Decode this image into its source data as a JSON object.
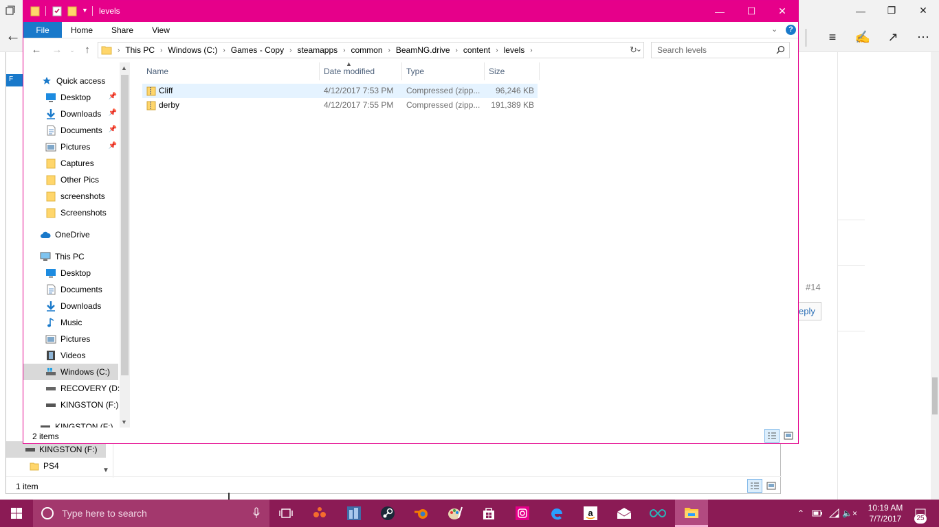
{
  "edge": {
    "post_number": "#14",
    "reply_label": "eply"
  },
  "bg_explorer": {
    "nav_items": [
      "KINGSTON (F:)",
      "PS4"
    ],
    "status": "1 item",
    "tab_letter": "F"
  },
  "window": {
    "title": "levels",
    "ribbon_tabs": [
      "File",
      "Home",
      "Share",
      "View"
    ],
    "breadcrumb": [
      "This PC",
      "Windows (C:)",
      "Games - Copy",
      "steamapps",
      "common",
      "BeamNG.drive",
      "content",
      "levels"
    ],
    "search_placeholder": "Search levels",
    "nav": {
      "quick_access": "Quick access",
      "quick_items": [
        "Desktop",
        "Downloads",
        "Documents",
        "Pictures",
        "Captures",
        "Other Pics",
        "screenshots",
        "Screenshots"
      ],
      "onedrive": "OneDrive",
      "this_pc": "This PC",
      "pc_items": [
        "Desktop",
        "Documents",
        "Downloads",
        "Music",
        "Pictures",
        "Videos",
        "Windows (C:)",
        "RECOVERY (D:)",
        "KINGSTON (F:)",
        "KINGSTON (F:)"
      ]
    },
    "columns": [
      "Name",
      "Date modified",
      "Type",
      "Size"
    ],
    "files": [
      {
        "name": "Cliff",
        "date": "4/12/2017 7:53 PM",
        "type": "Compressed (zipp...",
        "size": "96,246 KB"
      },
      {
        "name": "derby",
        "date": "4/12/2017 7:55 PM",
        "type": "Compressed (zipp...",
        "size": "191,389 KB"
      }
    ],
    "status": "2 items"
  },
  "taskbar": {
    "search_placeholder": "Type here to search",
    "time": "10:19 AM",
    "date": "7/7/2017",
    "notification_count": "25",
    "accent": "#8b1b55"
  },
  "colors": {
    "title_accent": "#e6008a",
    "file_tab": "#1979ca",
    "selection": "#e5f3ff"
  }
}
